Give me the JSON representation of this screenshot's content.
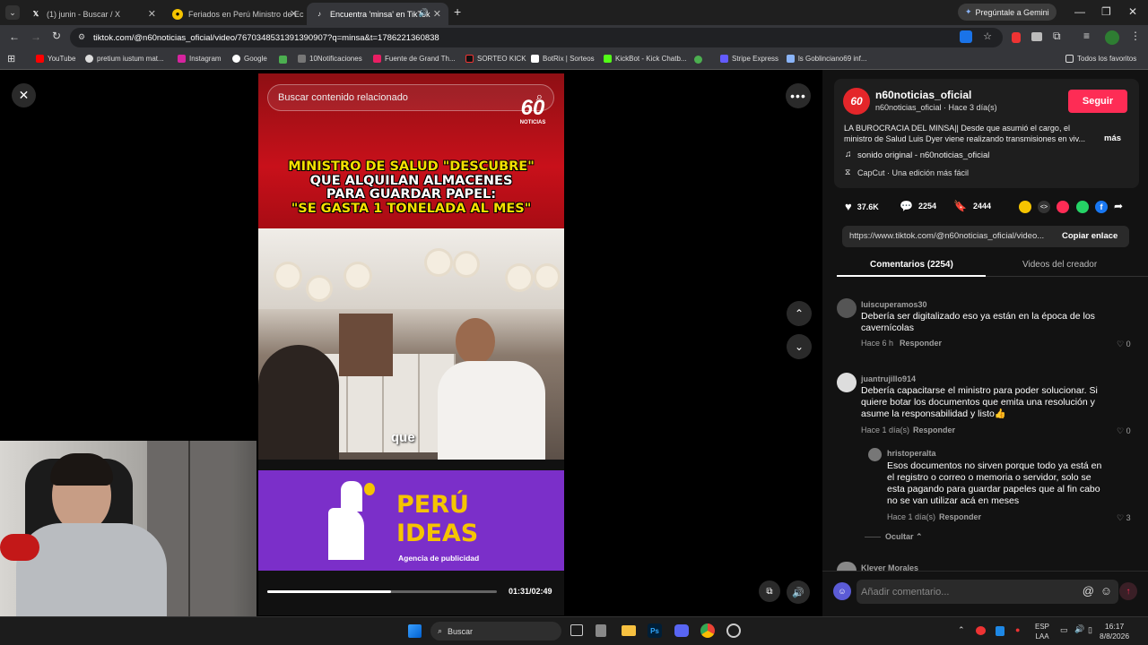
{
  "browser": {
    "tabs": [
      {
        "title": "(1) junin - Buscar / X",
        "icon": "x-logo-icon"
      },
      {
        "title": "Feriados en Perú Ministro de Ec",
        "icon": "news-icon"
      },
      {
        "title": "Encuentra 'minsa' en TikTok",
        "icon": "tiktok-icon"
      }
    ],
    "gemini_label": "Pregúntale a Gemini",
    "url": "tiktok.com/@n60noticias_oficial/video/7670348531391390907?q=minsa&t=1786221360838",
    "bookmarks": [
      "YouTube",
      "pretium iustum mat...",
      "Instagram",
      "Google",
      "10Notificaciones",
      "Fuente de Grand Th...",
      "SORTEO KICK",
      "BotRix | Sorteos",
      "KickBot - Kick Chatb...",
      "Stripe Express",
      "ls Goblinciano69 inf..."
    ],
    "all_favorites": "Todos los favoritos"
  },
  "video": {
    "search_placeholder": "Buscar contenido relacionado",
    "logo_number": "60",
    "logo_text": "NOTICIAS",
    "headline": [
      "MINISTRO DE SALUD \"DESCUBRE\"",
      "QUE ALQUILAN ALMACENES",
      "PARA GUARDAR PAPEL:",
      "\"SE GASTA 1 TONELADA AL MES\""
    ],
    "caption": "que",
    "ad_title_1": "PERÚ",
    "ad_title_2": "IDEAS",
    "ad_subtitle": "Agencia de publicidad",
    "time": "01:31/02:49",
    "progress": 0.54
  },
  "post": {
    "username": "n60noticias_oficial",
    "subtitle": "n60noticias_oficial · Hace 3 día(s)",
    "follow": "Seguir",
    "description": "LA BUROCRACIA DEL MINSA|| Desde que asumió el cargo, el ministro de Salud Luis Dyer viene realizando transmisiones en viv...",
    "more": "más",
    "sound": "sonido original - n60noticias_oficial",
    "capcut": "CapCut · Una edición más fácil",
    "likes": "37.6K",
    "comments": "2254",
    "saves": "2444",
    "link": "https://www.tiktok.com/@n60noticias_oficial/video...",
    "copy_link": "Copiar enlace",
    "tab_comments": "Comentarios (2254)",
    "tab_creator": "Videos del creador",
    "comment_placeholder": "Añadir comentario..."
  },
  "comments": [
    {
      "user": "luiscuperamos30",
      "text": "Debería ser digitalizado eso ya están en la época de los cavernícolas",
      "time": "Hace 6 h",
      "reply": "Responder",
      "likes": "0"
    },
    {
      "user": "juantrujillo914",
      "text": "Debería capacitarse el ministro para poder solucionar. Si quiere botar los documentos que emita una resolución y asume la responsabilidad y listo👍",
      "time": "Hace 1 día(s)",
      "reply": "Responder",
      "likes": "0"
    },
    {
      "user": "hristoperalta",
      "text": "Esos documentos no sirven porque todo ya está en el registro o correo o memoria o servidor, solo se esta pagando para guardar papeles que al fin cabo no se van utilizar acá en meses",
      "time": "Hace 1 día(s)",
      "reply": "Responder",
      "likes": "3"
    }
  ],
  "hide_label": "Ocultar",
  "next_user": "Klever Morales",
  "taskbar": {
    "search": "Buscar",
    "lang1": "ESP",
    "lang2": "LAA",
    "time": "16:17",
    "date": "8/8/2026"
  },
  "colors": {
    "accent": "#fe2c55",
    "ad_purple": "#7b2fc9",
    "headline_yellow": "#f5e000"
  }
}
